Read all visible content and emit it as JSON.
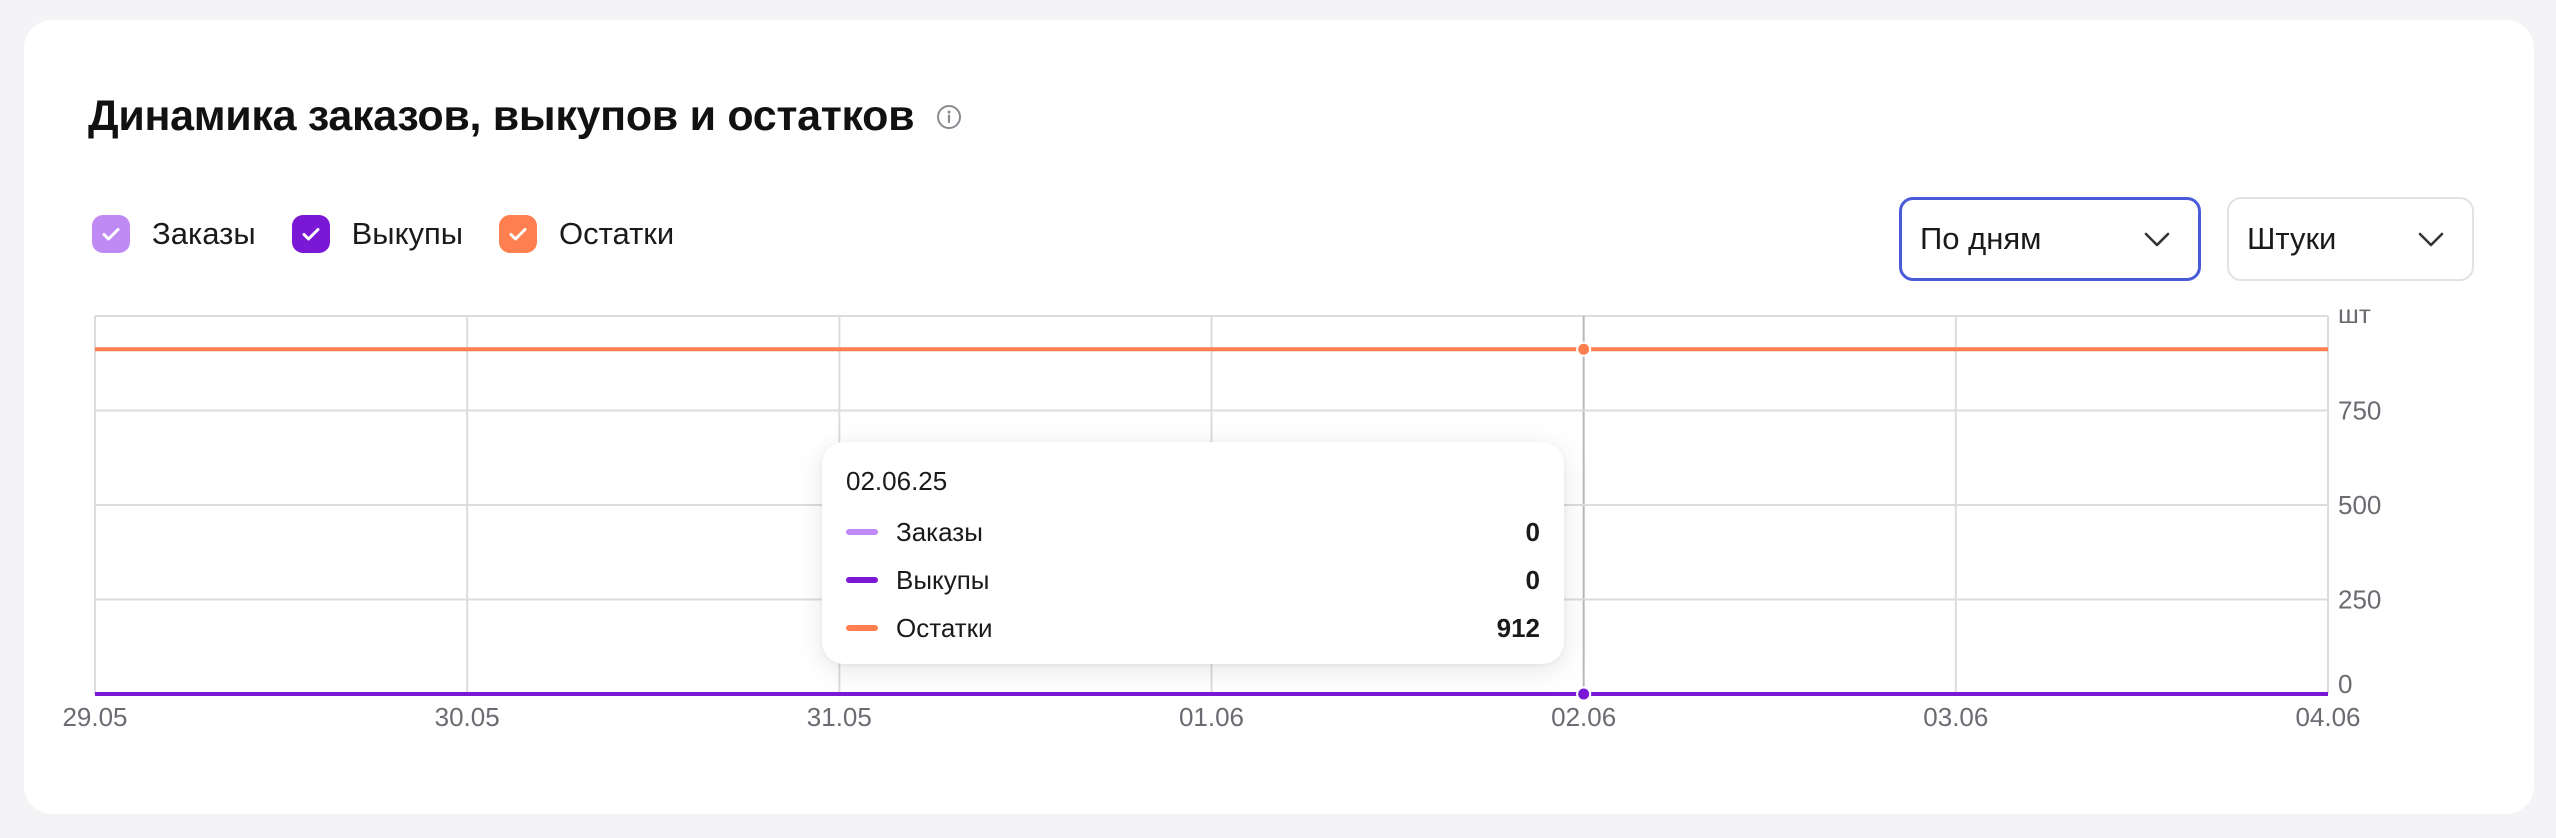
{
  "header": {
    "title": "Динамика заказов, выкупов и остатков",
    "info_icon": "info-circle-icon"
  },
  "legend": [
    {
      "label": "Заказы",
      "color": "#c08af5",
      "checked": true
    },
    {
      "label": "Выкупы",
      "color": "#7a18d6",
      "checked": true
    },
    {
      "label": "Остатки",
      "color": "#ff7f50",
      "checked": true
    }
  ],
  "controls": {
    "period": {
      "value": "По дням",
      "icon": "chevron-down-icon"
    },
    "unit": {
      "value": "Штуки",
      "icon": "chevron-down-icon"
    }
  },
  "chart_data": {
    "type": "line",
    "x": [
      "29.05",
      "30.05",
      "31.05",
      "01.06",
      "02.06",
      "03.06",
      "04.06"
    ],
    "series": [
      {
        "name": "Заказы",
        "color": "#c08af5",
        "values": [
          0,
          0,
          0,
          0,
          0,
          0,
          0
        ]
      },
      {
        "name": "Выкупы",
        "color": "#7a18d6",
        "values": [
          0,
          0,
          0,
          0,
          0,
          0,
          0
        ]
      },
      {
        "name": "Остатки",
        "color": "#ff7f50",
        "values": [
          912,
          912,
          912,
          912,
          912,
          912,
          912
        ]
      }
    ],
    "y_unit_label": "шт",
    "y_ticks": [
      0,
      250,
      500,
      750
    ],
    "ylim": [
      0,
      1000
    ],
    "grid": true,
    "highlight_index": 4
  },
  "tooltip": {
    "date": "02.06.25",
    "rows": [
      {
        "name": "Заказы",
        "value": "0",
        "color": "#c08af5"
      },
      {
        "name": "Выкупы",
        "value": "0",
        "color": "#7a18d6"
      },
      {
        "name": "Остатки",
        "value": "912",
        "color": "#ff7f50"
      }
    ]
  }
}
